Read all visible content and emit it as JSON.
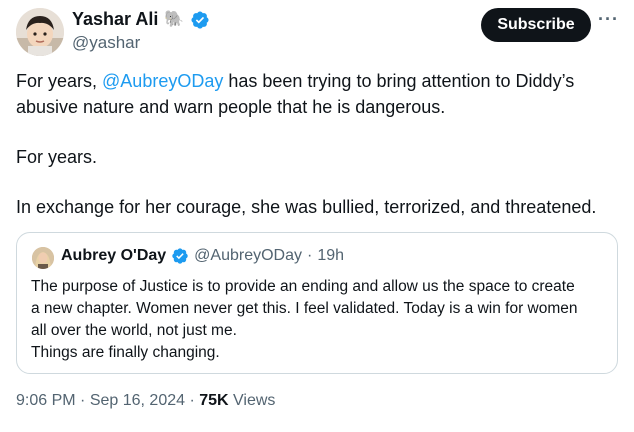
{
  "author": {
    "name": "Yashar Ali",
    "emoji": "🐘",
    "handle": "@yashar"
  },
  "subscribe_label": "Subscribe",
  "more_label": "···",
  "tweet": {
    "text_before_mention": "For years, ",
    "mention": "@AubreyODay",
    "text_after_mention": " has been trying to bring attention to Diddy’s abusive nature and warn people that he is dangerous.",
    "paragraph2": "For years.",
    "paragraph3": "In exchange for her courage, she was bullied, terrorized, and threatened."
  },
  "quote": {
    "name": "Aubrey O'Day",
    "handle": "@AubreyODay",
    "separator": "·",
    "time": "19h",
    "lines": [
      "The purpose of Justice is to provide an ending and allow us the space to create",
      "a new chapter. Women never get this. I feel validated. Today is a win for women",
      "all over the world, not just me.",
      "Things are finally changing."
    ]
  },
  "footer": {
    "time": "9:06 PM",
    "separator1": " · ",
    "date": "Sep 16, 2024",
    "separator2": " · ",
    "views_count": "75K",
    "views_label": " Views"
  },
  "colors": {
    "accent": "#1d9bf0",
    "text": "#0f1419",
    "muted": "#536471",
    "verified": "#1d9bf0",
    "border": "#cfd9de"
  }
}
